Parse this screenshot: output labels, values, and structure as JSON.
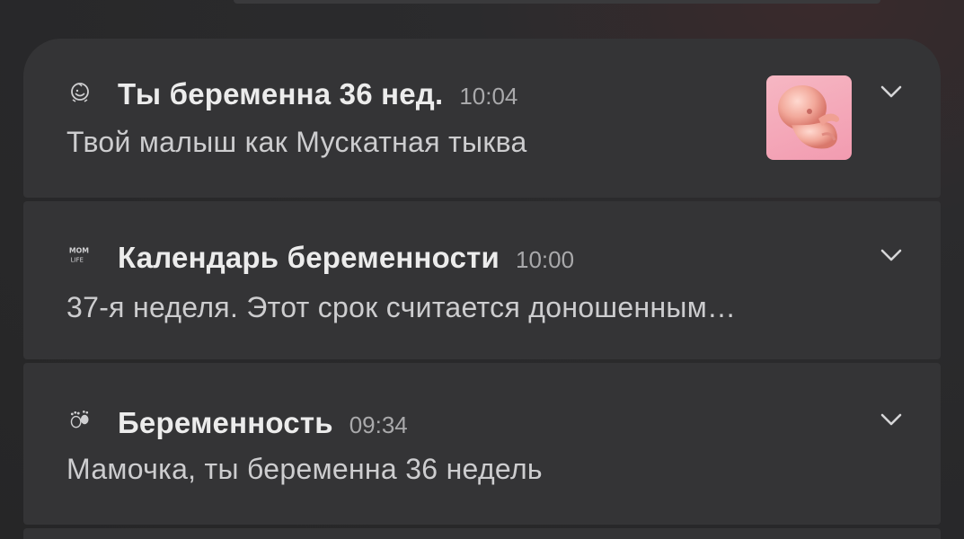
{
  "notifications": [
    {
      "title": "Ты беременна 36 нед.",
      "time": "10:04",
      "body": "Твой малыш как Мускатная тыква",
      "icon": "baby-face-icon",
      "has_thumbnail": true
    },
    {
      "title": "Календарь беременности",
      "time": "10:00",
      "body": "37-я неделя. Этот срок считается доношенным…",
      "icon": "mom-life-logo-icon",
      "icon_text": "MOM LIFE"
    },
    {
      "title": "Беременность",
      "time": "09:34",
      "body": "Мамочка, ты беременна 36 недель",
      "icon": "baby-footprints-icon"
    }
  ]
}
